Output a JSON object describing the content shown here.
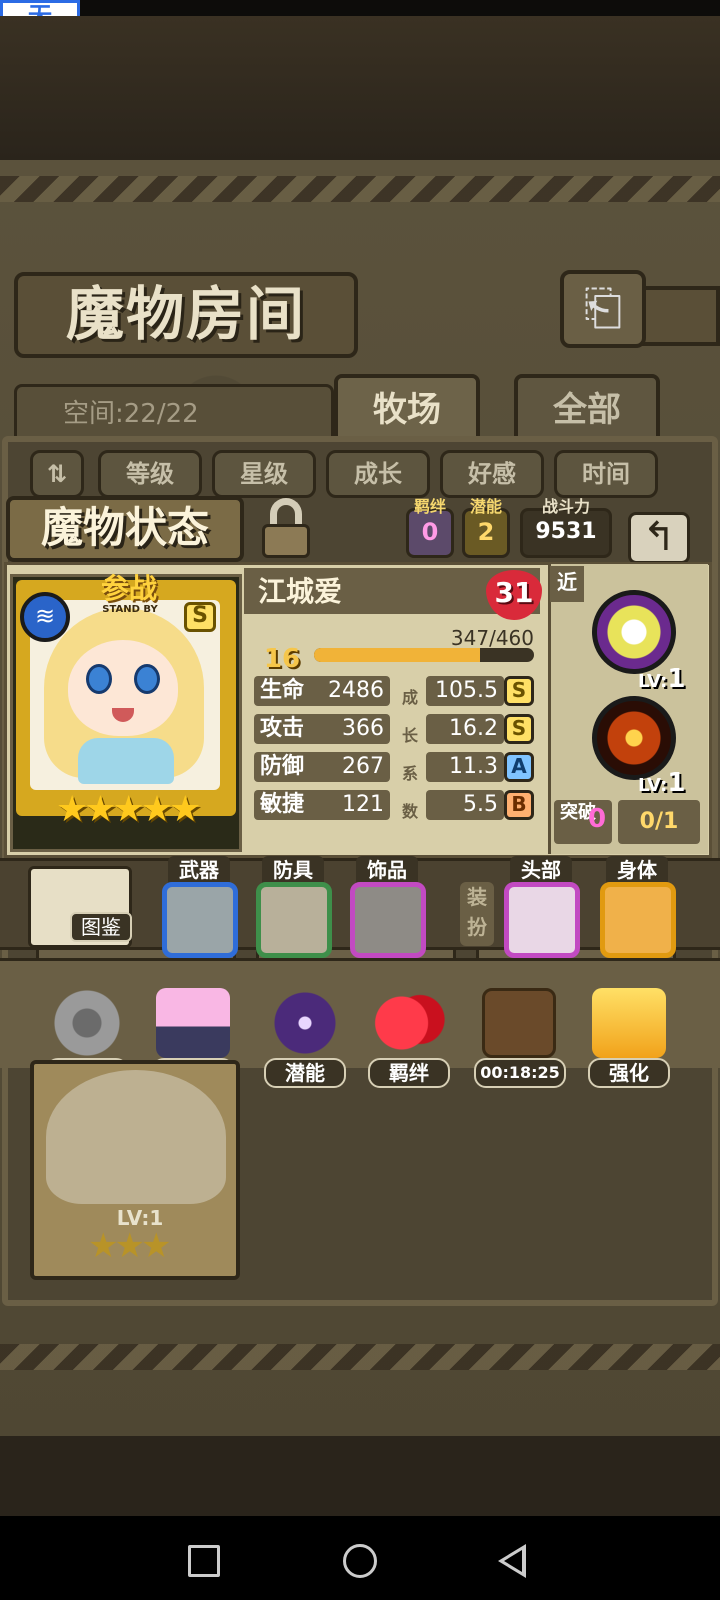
{
  "status_bar": {
    "badge": "无"
  },
  "header": {
    "title": "魔物房间",
    "back_icon": "return-arrow-icon"
  },
  "storage": {
    "space_text": "空间:22/22"
  },
  "tabs": [
    {
      "label": "牧场",
      "active": true
    },
    {
      "label": "全部",
      "active": false
    }
  ],
  "sort": {
    "order_icon": "sort-order-icon",
    "buttons": [
      "等级",
      "星级",
      "成长",
      "好感",
      "时间"
    ]
  },
  "status": {
    "title": "魔物状态",
    "bond": {
      "label": "羁绊",
      "value": "0"
    },
    "potential": {
      "label": "潜能",
      "value": "2"
    },
    "power": {
      "label": "战斗力",
      "value": "9531"
    }
  },
  "monster": {
    "name": "江城爱",
    "affection": "31",
    "standby": "参战",
    "standby_sub": "STAND BY",
    "rank": "S",
    "element_icon": "water-element-icon",
    "stars": "★★★★★",
    "star_count": 5,
    "level": "16",
    "exp_text": "347/460",
    "exp_fraction": 0.754,
    "stats": [
      {
        "label": "生命",
        "value": "2486",
        "growth": "105.5",
        "grade": "S"
      },
      {
        "label": "攻击",
        "value": "366",
        "growth": "16.2",
        "grade": "S"
      },
      {
        "label": "防御",
        "value": "267",
        "growth": "11.3",
        "grade": "A"
      },
      {
        "label": "敏捷",
        "value": "121",
        "growth": "5.5",
        "grade": "B"
      }
    ],
    "growth_chars": [
      "成",
      "长",
      "系",
      "数"
    ]
  },
  "skills": {
    "range_tag": "近",
    "items": [
      {
        "icon": "light-burst-skill-icon",
        "lv_label": "LV:",
        "lv": "1"
      },
      {
        "icon": "fire-sword-skill-icon",
        "lv_label": "LV:",
        "lv": "1"
      }
    ],
    "break_label": "突破",
    "break_value": "0",
    "break_count": "0/1"
  },
  "equipment": {
    "codex_label": "图鉴",
    "slots": [
      {
        "label": "武器",
        "icon": "gatling-gun-icon"
      },
      {
        "label": "防具",
        "icon": "hourglass-icon"
      },
      {
        "label": "饰品",
        "icon": "tree-card-icon"
      },
      {
        "label": "头部",
        "icon": "tiara-icon"
      },
      {
        "label": "身体",
        "icon": "pumpkin-costume-icon"
      }
    ],
    "dress_label": "装扮"
  },
  "actions": [
    {
      "label": "操作",
      "icon": "gear-icon"
    },
    {
      "label": "时装",
      "icon": "outfit-icon"
    },
    {
      "label": "潜能",
      "icon": "shadow-demon-icon"
    },
    {
      "label": "羁绊",
      "icon": "hearts-icon"
    },
    {
      "label": "00:18:25",
      "icon": "refresh-crate-icon"
    },
    {
      "label": "强化",
      "icon": "upgrade-arrows-icon"
    }
  ],
  "lower": {
    "lv_text": "LV:1",
    "stars": "★★★"
  },
  "colors": {
    "accent_gold": "#f1b338",
    "grade_s": "#ffe066",
    "grade_a": "#7fc3ff",
    "grade_b": "#ffb070",
    "heart_red": "#d92a3a"
  }
}
